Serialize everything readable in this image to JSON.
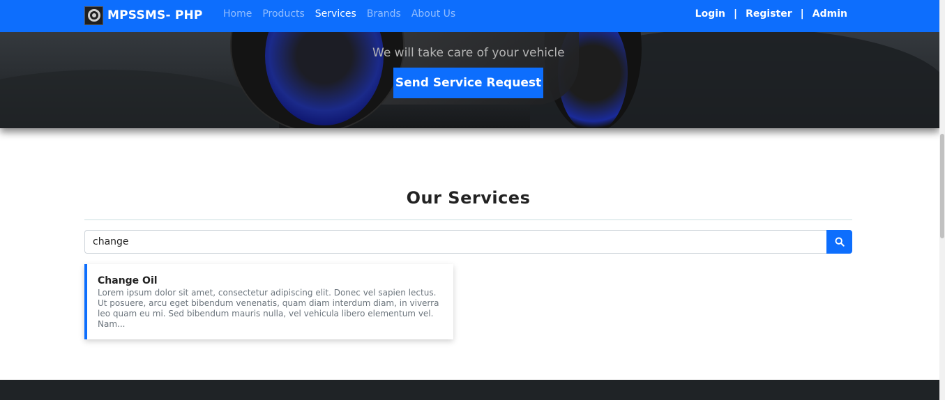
{
  "navbar": {
    "brand": "MPSSMS- PHP",
    "links": [
      "Home",
      "Products",
      "Services",
      "Brands",
      "About Us"
    ],
    "active": "Services",
    "auth": [
      "Login",
      "Register",
      "Admin"
    ],
    "separator": "|",
    "color": "#0d6efd"
  },
  "hero": {
    "subtitle": "We will take care of your vehicle",
    "button_label": "Send Service Request"
  },
  "services": {
    "title": "Our Services",
    "search_value": "change",
    "search_icon": "search-icon",
    "items": [
      {
        "title": "Change Oil",
        "description": "Lorem ipsum dolor sit amet, consectetur adipiscing elit. Donec vel sapien lectus. Ut posuere, arcu eget bibendum venenatis, quam diam interdum diam, in viverra leo quam eu mi. Sed bibendum mauris nulla, vel vehicula libero elementum vel. Nam..."
      }
    ]
  }
}
